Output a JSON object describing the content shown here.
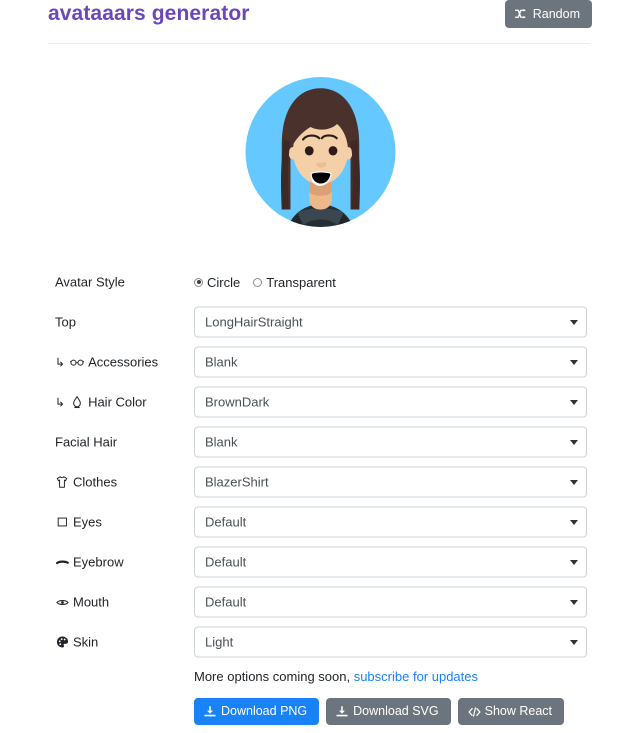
{
  "header": {
    "title": "avataaars generator",
    "random_label": "Random",
    "random_icon": "shuffle-icon",
    "title_color": "#6b47bb"
  },
  "avatar": {
    "style": "Circle",
    "circle_bg_color": "#65c9ff",
    "hair_color": "#4a312c",
    "skin_color": "#f4d0a9",
    "clothes_color": "#262e33",
    "collar_color": "#3a4750",
    "eye_color": "#2c1b18",
    "mouth_color": "#000000",
    "alt": "Avatar preview with LongHairStraight BrownDark hair, Light skin, BlazerShirt"
  },
  "form": {
    "rows": [
      {
        "label": "Avatar Style",
        "icon": null,
        "sub": false,
        "type": "radio",
        "options": [
          "Circle",
          "Transparent"
        ],
        "value": "Circle"
      },
      {
        "label": "Top",
        "icon": null,
        "sub": false,
        "type": "select",
        "value": "LongHairStraight"
      },
      {
        "label": "Accessories",
        "icon": "glasses-icon",
        "sub": true,
        "type": "select",
        "value": "Blank"
      },
      {
        "label": "Hair Color",
        "icon": "hair-color-icon",
        "sub": true,
        "type": "select",
        "value": "BrownDark"
      },
      {
        "label": "Facial Hair",
        "icon": null,
        "sub": false,
        "type": "select",
        "value": "Blank"
      },
      {
        "label": "Clothes",
        "icon": "tshirt-icon",
        "sub": false,
        "type": "select",
        "value": "BlazerShirt"
      },
      {
        "label": "Eyes",
        "icon": "eye-square-icon",
        "sub": false,
        "type": "select",
        "value": "Default"
      },
      {
        "label": "Eyebrow",
        "icon": "eyebrow-dash-icon",
        "sub": false,
        "type": "select",
        "value": "Default"
      },
      {
        "label": "Mouth",
        "icon": "mouth-icon",
        "sub": false,
        "type": "select",
        "value": "Default"
      },
      {
        "label": "Skin",
        "icon": "palette-icon",
        "sub": false,
        "type": "select",
        "value": "Light"
      }
    ]
  },
  "footer": {
    "note_text": "More options coming soon, ",
    "note_link": "subscribe for updates",
    "buttons": [
      {
        "label": "Download PNG",
        "icon": "download-icon",
        "variant": "primary"
      },
      {
        "label": "Download SVG",
        "icon": "download-icon",
        "variant": "secondary"
      },
      {
        "label": "Show React",
        "icon": "code-icon",
        "variant": "secondary"
      }
    ]
  }
}
